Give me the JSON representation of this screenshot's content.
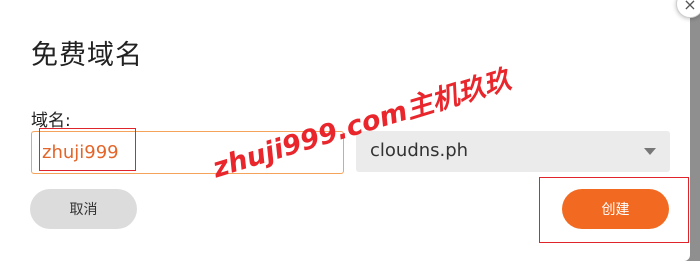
{
  "dialog": {
    "title": "免费域名",
    "close_icon_glyph": "×"
  },
  "form": {
    "domain_label": "域名:",
    "domain_value": "zhuji999",
    "zone_selected": "cloudns.ph"
  },
  "buttons": {
    "cancel_label": "取消",
    "create_label": "创建"
  },
  "watermark": {
    "text": "zhuji999.com主机玖玖"
  },
  "colors": {
    "accent": "#f26a21",
    "highlight": "#e0242b"
  }
}
